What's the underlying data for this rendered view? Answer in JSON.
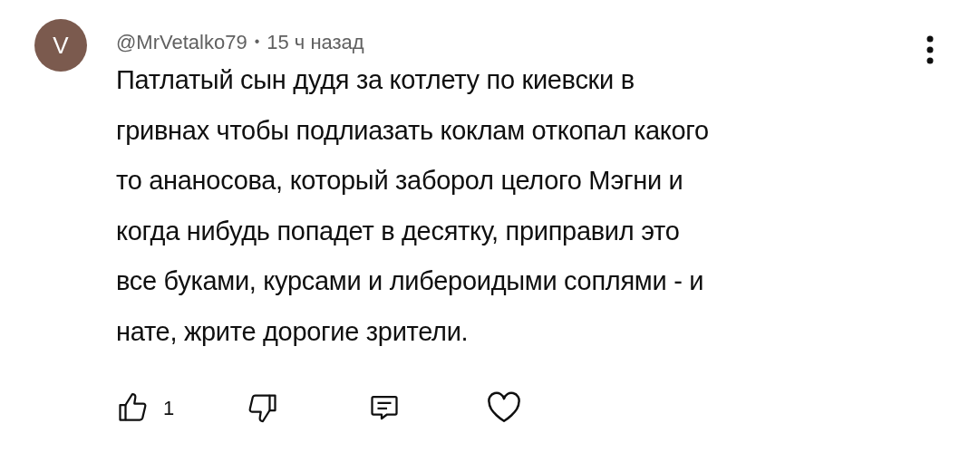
{
  "comment": {
    "avatar_letter": "V",
    "author": "@MrVetalko79",
    "separator": "•",
    "time": "15 ч назад",
    "text": "Патлатый сын дудя за котлету по киевски в\nгривнах чтобы подлиазать коклам откопал какого\nто ананосова, который заборол целого Мэгни и\nкогда нибудь попадет в десятку, приправил это\nвсе буками, курсами и либероидыми соплями  - и\nнате, жрите дорогие зрители.",
    "likes": "1"
  }
}
